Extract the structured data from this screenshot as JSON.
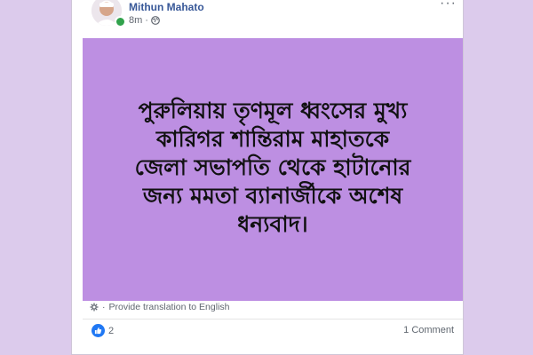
{
  "post": {
    "author": "Mithun Mahato",
    "time": "8m",
    "privacy_icon": "globe-icon",
    "text_lines": [
      "পুরুলিয়ায় তৃণমূল ধ্বংসের মুখ্য",
      "কারিগর শান্তিরাম মাহাতকে",
      "জেলা সভাপতি থেকে হাটানোর",
      "জন্য মমতা ব্যানার্জীকে অশেষ",
      "ধন্যবাদ।"
    ],
    "background_color": "#bd8fe2",
    "translate_label": "Provide translation to English",
    "translate_separator": "·",
    "reaction_count": "2",
    "comment_label": "1 Comment",
    "more_label": "···"
  },
  "colors": {
    "page_bg": "#dccbec",
    "author_link": "#385898",
    "like_blue": "#2078f4",
    "online_green": "#31a24c"
  }
}
